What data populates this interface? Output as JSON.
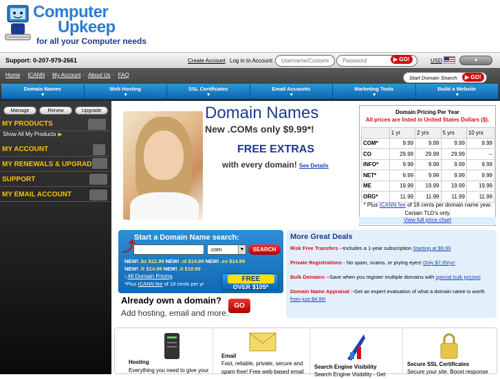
{
  "logo": {
    "line1": "Computer",
    "line2": "Upkeep",
    "tagline": "for all your Computer needs"
  },
  "account_bar": {
    "support": "Support: 0-207-979-2661",
    "create_account": "Create Account",
    "login_label": "Log in to Account:",
    "username_placeholder": "Username/Customer #",
    "password_placeholder": "Password",
    "go_label": "GO!",
    "currency": "USD"
  },
  "breadcrumb": [
    "Home",
    "ICANN",
    "My Account",
    "About Us",
    "FAQ"
  ],
  "domain_search_pill": {
    "placeholder": "Start Domain Search",
    "go_label": "GO!"
  },
  "main_nav": [
    "Domain Names",
    "Web Hosting",
    "SSL Certificates",
    "Email Accounts",
    "Marketing Tools",
    "Build a Website"
  ],
  "sidebar": {
    "buttons": [
      "Manage",
      "Renew",
      "Upgrade"
    ],
    "sections": [
      {
        "title": "MY PRODUCTS",
        "sub": "Show All My Products"
      },
      {
        "title": "MY ACCOUNT"
      },
      {
        "title": "MY RENEWALS & UPGRADES"
      },
      {
        "title": "SUPPORT"
      },
      {
        "title": "MY EMAIL ACCOUNT"
      }
    ]
  },
  "promo": {
    "title": "Domain Names",
    "subtitle": "New .COMs only $9.99*!",
    "free_extras": "FREE EXTRAS",
    "every_domain": "with every domain!",
    "see_details": "See Details"
  },
  "pricing": {
    "title": "Domain Pricing Per Year",
    "note": "All prices are listed in United States Dollars ($).",
    "headers": [
      "",
      "1 yr",
      "2 yrs",
      "5 yrs",
      "10 yrs"
    ],
    "rows": [
      [
        "COM*",
        "9.99",
        "9.99",
        "9.99",
        "9.99"
      ],
      [
        "CO",
        "29.99",
        "29.99",
        "29.99",
        "--"
      ],
      [
        "INFO*",
        "9.99",
        "9.99",
        "9.99",
        "9.99"
      ],
      [
        "NET*",
        "9.99",
        "9.99",
        "9.99",
        "9.99"
      ],
      [
        "ME",
        "19.99",
        "19.99",
        "19.99",
        "19.99"
      ],
      [
        "ORG*",
        "11.99",
        "11.99",
        "11.99",
        "11.99"
      ]
    ],
    "foot_prefix": "* Plus",
    "foot_link": "ICANN fee",
    "foot_suffix": "of 18 cents per domain name year.",
    "foot_line2": "Certain TLD's only.",
    "full_price": "View full price chart"
  },
  "search_box": {
    "title": "Start a Domain Name search:",
    "tld_value": ".com",
    "search_label": "SEARCH",
    "new_line1": [
      {
        "label": "NEW!",
        "tld": ".bz $12.99"
      },
      {
        "label": "NEW!",
        "tld": ".nl $14.99"
      },
      {
        "label": "NEW!",
        "tld": ".es $14.99"
      }
    ],
    "new_line2": [
      {
        "label": "NEW!",
        "tld": ".fr $14.99"
      },
      {
        "label": "NEW!",
        "tld": ".it $19.99"
      }
    ],
    "all_pricing": "All Domain Pricing",
    "icann_prefix": "*Plus",
    "icann_link": "ICANN fee",
    "icann_suffix": "of 18 cents per yr",
    "badge_top": "FREE EXTRAS!",
    "badge_bot": "OVER $105*"
  },
  "own_domain": {
    "title": "Already own a domain?",
    "sub": "Add hosting, email and more.",
    "go": "GO"
  },
  "deals": {
    "title": "More Great Deals",
    "items": [
      {
        "name": "Risk Free Transfers",
        "text": " --Includes a 1-year subscription ",
        "link": "Starting at $9.99"
      },
      {
        "name": "Private Registrations",
        "text": " - No spam, scams, or prying eyes! ",
        "link": "Only $7.95/yr!"
      },
      {
        "name": "Bulk Domains",
        "text": " --Save when you register multiple domains with ",
        "link": "special bulk pricing!"
      },
      {
        "name": "Domain Name Appraisal",
        "text": " --Get an expert evaluation of what a domain name is worth ",
        "link": "from just $4.99!"
      }
    ]
  },
  "features": [
    {
      "title": "Hosting",
      "body": "Everything you need to give your"
    },
    {
      "title": "Email",
      "body": "Fast, reliable, private, secure and spam-free! Free web-based email"
    },
    {
      "title": "Search Engine Visibility",
      "body": "Search Engine Visibility - Get"
    },
    {
      "title": "Secure SSL Certificates",
      "body": "Secure your site. Boost response"
    }
  ],
  "colors": {
    "brand_blue": "#2a7bd6",
    "nav_blue": "#0c67b0",
    "accent_red": "#cc1111",
    "sidebar_yellow": "#f5c400"
  }
}
